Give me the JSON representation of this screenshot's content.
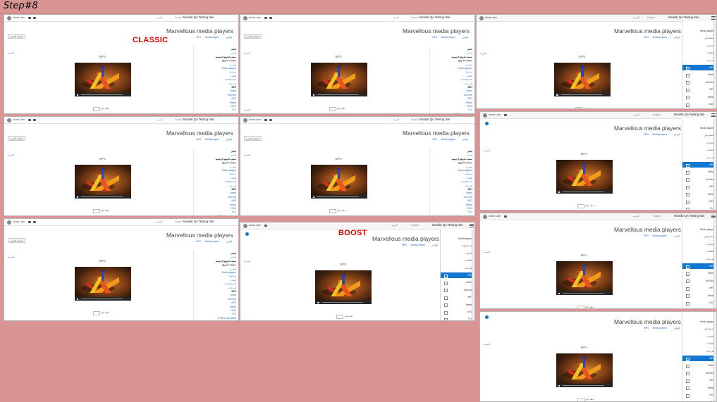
{
  "step": {
    "label": "Step#8"
  },
  "labels": {
    "classic": "CLASSIC",
    "boost": "BOOST"
  },
  "site": {
    "name": "Moodle QA Testing Site",
    "language": "English",
    "lang_ar": "العربية",
    "user": "Admin User",
    "page_title": "Marvellous media players",
    "left_link": "العربية",
    "video_title": "MP4",
    "nav_button": "ذهاب إلى",
    "nav_box": "التالي",
    "edit_button": "تشغيل التحرير"
  },
  "breadcrumb": {
    "home": "لوحتي",
    "course": "Media players",
    "activity": "MP4"
  },
  "classic_blocks": [
    {
      "label": "التنقل",
      "style": "dark"
    },
    {
      "label": "لوحتي",
      "style": "link"
    },
    {
      "label": "صفحة الموقع الرئيسية",
      "style": "dark"
    },
    {
      "label": "صفحات الموقع",
      "style": "dark"
    },
    {
      "label": "مقرري",
      "style": "link"
    },
    {
      "label": "Media players",
      "style": "link"
    },
    {
      "label": "مراسلة",
      "style": "link"
    },
    {
      "label": "الفئات",
      "style": "link"
    },
    {
      "label": "الاستطلاعات",
      "style": "link"
    },
    {
      "label": "الدرجات",
      "style": "link"
    },
    {
      "label": "MP4",
      "style": "dark"
    },
    {
      "label": "Vimeo",
      "style": "link"
    },
    {
      "label": "YouTube",
      "style": "link"
    },
    {
      "label": "MP3",
      "style": "link"
    },
    {
      "label": "Webm",
      "style": "link"
    },
    {
      "label": "OGG",
      "style": "link"
    },
    {
      "label": "FLV",
      "style": "link"
    },
    {
      "label": "HTML5 embedded",
      "style": "link"
    }
  ],
  "boost_drawer": [
    {
      "label": "Media players",
      "active": false
    },
    {
      "label": "المشاركون",
      "active": false
    },
    {
      "label": "الشارات",
      "active": false
    },
    {
      "label": "الكفايات",
      "active": false
    },
    {
      "label": "الدرجات",
      "active": false
    },
    {
      "label": "MP4",
      "active": true
    },
    {
      "label": "Vimeo",
      "active": false
    },
    {
      "label": "YouTube",
      "active": false
    },
    {
      "label": "MP3",
      "active": false
    },
    {
      "label": "Webm",
      "active": false
    },
    {
      "label": "OGG",
      "active": false
    },
    {
      "label": "FLV",
      "active": false
    },
    {
      "label": "HTML5 embedded",
      "active": false
    }
  ],
  "colors": {
    "background": "#d99594",
    "label": "#dd0000",
    "active": "#1177d1",
    "link": "#2a6ab8"
  },
  "icons": [
    "avatar-icon",
    "bell-icon",
    "message-icon",
    "hamburger-icon",
    "gear-icon",
    "sidebar-toggle-icon"
  ]
}
